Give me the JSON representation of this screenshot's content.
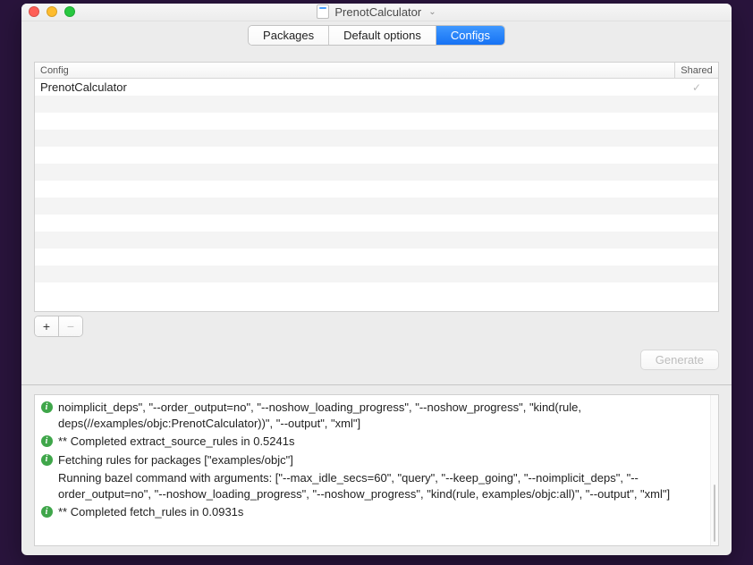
{
  "window": {
    "title": "PrenotCalculator"
  },
  "tabs": {
    "packages": "Packages",
    "default_options": "Default options",
    "configs": "Configs",
    "selected": "configs"
  },
  "table": {
    "headers": {
      "config": "Config",
      "shared": "Shared"
    },
    "rows": [
      {
        "name": "PrenotCalculator",
        "shared": true
      }
    ]
  },
  "buttons": {
    "generate": "Generate"
  },
  "log": {
    "lines": [
      {
        "icon": "info",
        "text": "noimplicit_deps\", \"--order_output=no\", \"--noshow_loading_progress\", \"--noshow_progress\", \"kind(rule, deps(//examples/objc:PrenotCalculator))\", \"--output\", \"xml\"]"
      },
      {
        "icon": "info",
        "text": "** Completed extract_source_rules in 0.5241s"
      },
      {
        "icon": "info",
        "text": "Fetching rules for packages [\"examples/objc\"]"
      },
      {
        "icon": "",
        "text": "Running bazel command with arguments: [\"--max_idle_secs=60\", \"query\", \"--keep_going\", \"--noimplicit_deps\", \"--order_output=no\", \"--noshow_loading_progress\", \"--noshow_progress\", \"kind(rule, examples/objc:all)\", \"--output\", \"xml\"]"
      },
      {
        "icon": "info",
        "text": "** Completed fetch_rules in 0.0931s"
      }
    ]
  }
}
